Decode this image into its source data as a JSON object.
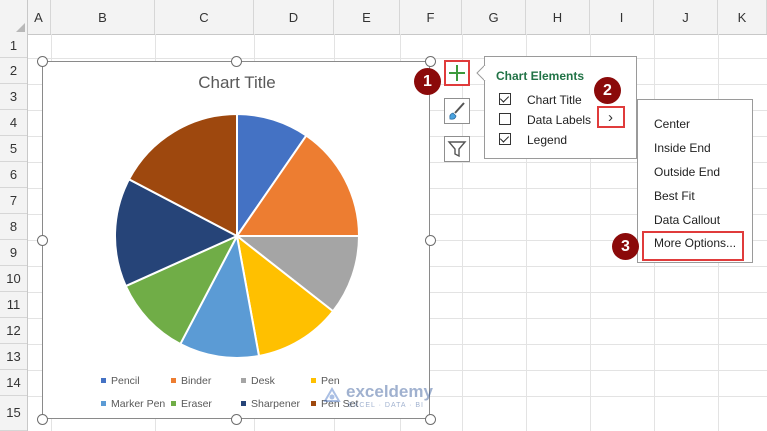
{
  "columns": [
    "A",
    "B",
    "C",
    "D",
    "E",
    "F",
    "G",
    "H",
    "I",
    "J",
    "K"
  ],
  "rows": [
    "1",
    "2",
    "3",
    "4",
    "5",
    "6",
    "7",
    "8",
    "9",
    "10",
    "11",
    "12",
    "13",
    "14",
    "15"
  ],
  "chart": {
    "title": "Chart Title",
    "legend": [
      "Pencil",
      "Binder",
      "Desk",
      "Pen",
      "Marker Pen",
      "Eraser",
      "Sharpener",
      "Pen Set"
    ]
  },
  "chart_data": {
    "type": "pie",
    "title": "Chart Title",
    "categories": [
      "Pencil",
      "Binder",
      "Desk",
      "Pen",
      "Marker Pen",
      "Eraser",
      "Sharpener",
      "Pen Set"
    ],
    "values": [
      10,
      16,
      11,
      12,
      11,
      11,
      15,
      18
    ],
    "colors": [
      "#4472c4",
      "#ed7d31",
      "#a5a5a5",
      "#ffc000",
      "#5b9bd5",
      "#70ad47",
      "#264478",
      "#9e480e"
    ],
    "legend_position": "bottom"
  },
  "side_buttons": [
    "chart-elements-plus-icon",
    "chart-styles-brush-icon",
    "chart-filters-funnel-icon"
  ],
  "chart_elements": {
    "title": "Chart Elements",
    "items": [
      {
        "label": "Chart Title",
        "checked": true
      },
      {
        "label": "Data Labels",
        "checked": false
      },
      {
        "label": "Legend",
        "checked": true
      }
    ],
    "arrow": "›"
  },
  "data_labels_menu": {
    "items": [
      "Center",
      "Inside End",
      "Outside End",
      "Best Fit",
      "Data Callout",
      "More Options..."
    ]
  },
  "badges": [
    "1",
    "2",
    "3"
  ],
  "watermark": {
    "name": "exceldemy",
    "tagline": "EXCEL · DATA · BI"
  },
  "colors": {
    "accent_red": "#e03b3b",
    "badge": "#8b0a0a",
    "panel_title": "#217346"
  }
}
